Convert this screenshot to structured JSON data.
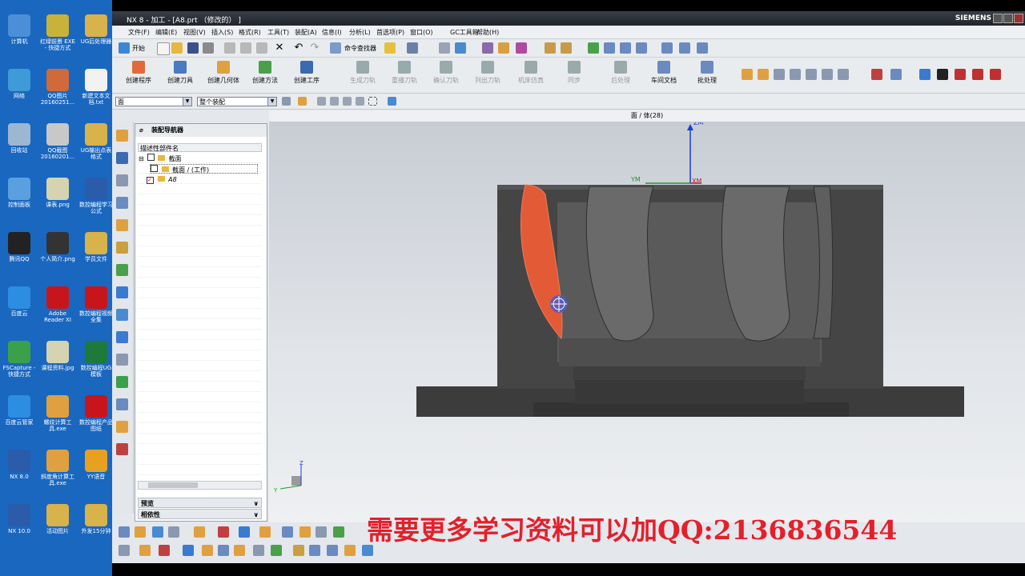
{
  "desktop": {
    "icons": [
      {
        "label": "计算机",
        "color": "#4b8fd6"
      },
      {
        "label": "红绿前景 EXE - 快捷方式",
        "color": "#c9b23a"
      },
      {
        "label": "UG后处理器",
        "color": "#d8b24a"
      },
      {
        "label": "网络",
        "color": "#3f9ad8"
      },
      {
        "label": "QQ图片 20160251...",
        "color": "#d06a3c"
      },
      {
        "label": "新建文本文档.txt",
        "color": "#f2f2f2"
      },
      {
        "label": "回收站",
        "color": "#9db7d3"
      },
      {
        "label": "QQ截图 20160201...",
        "color": "#c8c8c8"
      },
      {
        "label": "UG输出点表格式",
        "color": "#d8b24a"
      },
      {
        "label": "控制面板",
        "color": "#5aa0e0"
      },
      {
        "label": "课表.png",
        "color": "#d6d3b0"
      },
      {
        "label": "数控编程学习公式",
        "color": "#2b5caa"
      },
      {
        "label": "腾讯QQ",
        "color": "#222222"
      },
      {
        "label": "个人简介.png",
        "color": "#333333"
      },
      {
        "label": "学员文件",
        "color": "#d8b24a"
      },
      {
        "label": "百度云",
        "color": "#2d8de0"
      },
      {
        "label": "Adobe Reader XI",
        "color": "#c8151b"
      },
      {
        "label": "数控编程视频全集",
        "color": "#c8151b"
      },
      {
        "label": "FSCapture - 快捷方式",
        "color": "#3aa04a"
      },
      {
        "label": "课程资料.jpg",
        "color": "#d6d3b0"
      },
      {
        "label": "数控编程UG模板",
        "color": "#1d7a3a"
      },
      {
        "label": "百度云管家",
        "color": "#2d8de0"
      },
      {
        "label": "螺纹计算工具.exe",
        "color": "#e0a040"
      },
      {
        "label": "数控编程产品图纸",
        "color": "#c8151b"
      },
      {
        "label": "NX 8.0",
        "color": "#2b5caa"
      },
      {
        "label": "斜度角计算工具.exe",
        "color": "#e0a040"
      },
      {
        "label": "YY语音",
        "color": "#e8a020"
      },
      {
        "label": "NX 10.0",
        "color": "#2b5caa"
      },
      {
        "label": "活动图片",
        "color": "#d8b24a"
      },
      {
        "label": "外发15分钟",
        "color": "#d8b24a"
      }
    ]
  },
  "window": {
    "title": "NX 8 - 加工 - [A8.prt （修改的） ]",
    "brand": "SIEMENS"
  },
  "menu": [
    "文件(F)",
    "编辑(E)",
    "视图(V)",
    "插入(S)",
    "格式(R)",
    "工具(T)",
    "装配(A)",
    "信息(I)",
    "分析(L)",
    "首选项(P)",
    "窗口(O)",
    "GC工具箱",
    "帮助(H)"
  ],
  "toolbar1": {
    "start_label": "开始",
    "command_finder": "命令查找器"
  },
  "toolbar2": {
    "buttons": [
      {
        "label": "创建程序",
        "enabled": true
      },
      {
        "label": "创建刀具",
        "enabled": true
      },
      {
        "label": "创建几何体",
        "enabled": true
      },
      {
        "label": "创建方法",
        "enabled": true
      },
      {
        "label": "创建工序",
        "enabled": true
      },
      {
        "label": "生成刀轨",
        "enabled": false
      },
      {
        "label": "重播刀轨",
        "enabled": false
      },
      {
        "label": "确认刀轨",
        "enabled": false
      },
      {
        "label": "列出刀轨",
        "enabled": false
      },
      {
        "label": "机床仿真",
        "enabled": false
      },
      {
        "label": "同步",
        "enabled": false
      },
      {
        "label": "后处理",
        "enabled": false
      },
      {
        "label": "车间文档",
        "enabled": true
      },
      {
        "label": "批处理",
        "enabled": true
      }
    ]
  },
  "toolbar3": {
    "filter_value": "面",
    "scope_value": "整个装配"
  },
  "viewport": {
    "title": "面 / 体(28)",
    "axis_labels": {
      "z": "ZM",
      "y": "YM",
      "x": "XM"
    },
    "triad": {
      "z": "Z",
      "y": "Y"
    }
  },
  "navigator": {
    "title": "装配导航器",
    "column_header": "描述性部件名",
    "rows": [
      {
        "label": "截面",
        "indent": 0
      },
      {
        "label": "截面 / (工作)",
        "indent": 1
      },
      {
        "label": "A8",
        "indent": 0
      }
    ],
    "panes": [
      "预览",
      "相依性"
    ]
  },
  "watermark": "需要更多学习资料可以加QQ:2136836544"
}
